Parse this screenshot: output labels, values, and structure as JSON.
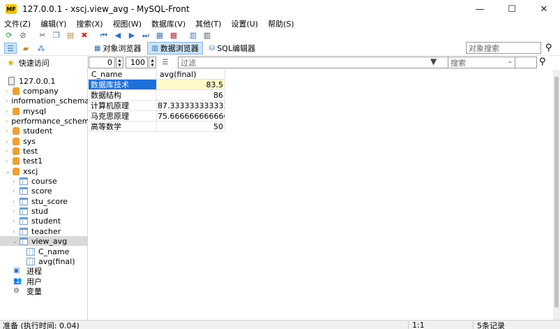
{
  "window": {
    "title": "127.0.0.1 - xscj.view_avg - MySQL-Front",
    "app_badge": "MF",
    "minimize": "—",
    "maximize": "☐",
    "close": "✕"
  },
  "menu": [
    "文件(Z)",
    "编辑(Y)",
    "搜索(X)",
    "视图(W)",
    "数据库(V)",
    "其他(T)",
    "设置(U)",
    "帮助(S)"
  ],
  "view_tabs": {
    "object_browser": "对象浏览器",
    "data_browser": "数据浏览器",
    "sql_editor": "SQL编辑器"
  },
  "object_search_placeholder": "对象搜索",
  "sidebar": {
    "quick_access": "快速访问",
    "server": "127.0.0.1",
    "databases": [
      "company",
      "information_schema",
      "mysql",
      "performance_schema",
      "student",
      "sys",
      "test",
      "test1"
    ],
    "open_db": "xscj",
    "tables": [
      "course",
      "score",
      "stu_score",
      "stud",
      "student",
      "teacher"
    ],
    "selected_view": "view_avg",
    "fields": [
      "C_name",
      "avg(final)"
    ],
    "extras": [
      "进程",
      "用户",
      "变量"
    ]
  },
  "navigator": {
    "offset": "0",
    "limit": "100",
    "filter_placeholder": "过滤",
    "search_placeholder": "搜索"
  },
  "grid": {
    "columns": [
      "C_name",
      "avg(final)"
    ],
    "rows": [
      [
        "数据库技术",
        "83.5"
      ],
      [
        "数据结构",
        "86"
      ],
      [
        "计算机原理",
        "87.3333333333333"
      ],
      [
        "马克思原理",
        "75.6666666666666"
      ],
      [
        "高等数学",
        "50"
      ]
    ]
  },
  "status": {
    "left": "准备 (执行时间: 0.04)",
    "position": "1:1",
    "records": "5条记录"
  }
}
